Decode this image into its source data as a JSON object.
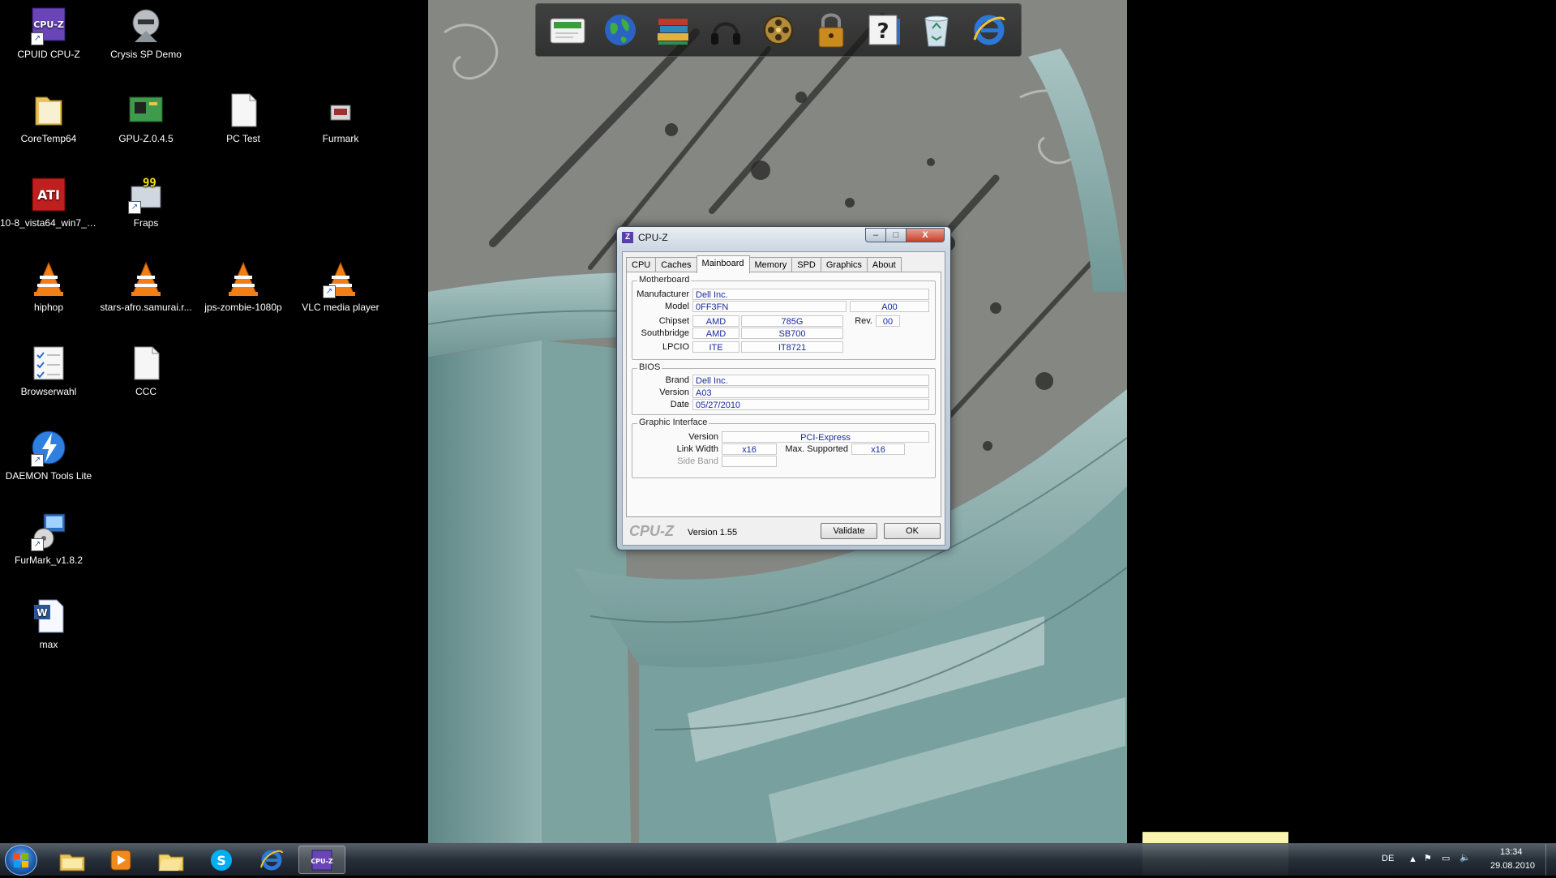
{
  "desktop": {
    "icons": [
      {
        "label": "CPUID CPU-Z",
        "icon": "cpuz-icon"
      },
      {
        "label": "Crysis SP Demo",
        "icon": "crysis-icon"
      },
      {
        "label": "CoreTemp64",
        "icon": "folder-icon"
      },
      {
        "label": "GPU-Z.0.4.5",
        "icon": "gpuz-icon"
      },
      {
        "label": "PC Test",
        "icon": "document-icon"
      },
      {
        "label": "Furmark",
        "icon": "furmark-icon"
      },
      {
        "label": "10-8_vista64_win7_6...",
        "icon": "ati-icon"
      },
      {
        "label": "Fraps",
        "icon": "fraps-icon"
      },
      {
        "label": "hiphop",
        "icon": "vlc-icon"
      },
      {
        "label": "stars-afro.samurai.r...",
        "icon": "vlc-icon"
      },
      {
        "label": "jps-zombie-1080p",
        "icon": "vlc-icon"
      },
      {
        "label": "VLC media player",
        "icon": "vlc-icon"
      },
      {
        "label": "Browserwahl",
        "icon": "checklist-icon"
      },
      {
        "label": "CCC",
        "icon": "document-icon"
      },
      {
        "label": "DAEMON Tools Lite",
        "icon": "daemon-icon"
      },
      {
        "label": "FurMark_v1.8.2",
        "icon": "furmark-setup-icon"
      },
      {
        "label": "max",
        "icon": "word-icon"
      }
    ]
  },
  "dock": {
    "items": [
      "mail-icon",
      "globe-icon",
      "books-icon",
      "headphones-icon",
      "film-reel-icon",
      "padlock-icon",
      "help-icon",
      "recycle-bin-icon",
      "internet-explorer-icon"
    ]
  },
  "cpuz": {
    "title": "CPU-Z",
    "window_buttons": {
      "minimize": "–",
      "maximize": "□",
      "close": "X"
    },
    "tabs": [
      "CPU",
      "Caches",
      "Mainboard",
      "Memory",
      "SPD",
      "Graphics",
      "About"
    ],
    "active_tab": "Mainboard",
    "motherboard": {
      "label": "Motherboard",
      "manufacturer_label": "Manufacturer",
      "manufacturer": "Dell Inc.",
      "model_label": "Model",
      "model": "0FF3FN",
      "model_rev": "A00",
      "chipset_label": "Chipset",
      "chipset_vendor": "AMD",
      "chipset_model": "785G",
      "rev_label": "Rev.",
      "rev": "00",
      "southbridge_label": "Southbridge",
      "southbridge_vendor": "AMD",
      "southbridge_model": "SB700",
      "lpcio_label": "LPCIO",
      "lpcio_vendor": "ITE",
      "lpcio_model": "IT8721"
    },
    "bios": {
      "label": "BIOS",
      "brand_label": "Brand",
      "brand": "Dell Inc.",
      "version_label": "Version",
      "version": "A03",
      "date_label": "Date",
      "date": "05/27/2010"
    },
    "graphic_interface": {
      "label": "Graphic Interface",
      "version_label": "Version",
      "version": "PCI-Express",
      "link_width_label": "Link Width",
      "link_width": "x16",
      "max_supported_label": "Max. Supported",
      "max_supported": "x16",
      "side_band_label": "Side Band",
      "side_band": ""
    },
    "footer": {
      "brand": "CPU-Z",
      "version": "Version 1.55",
      "validate_label": "Validate",
      "ok_label": "OK"
    }
  },
  "taskbar": {
    "items": [
      "explorer-icon",
      "media-player-icon",
      "folder-icon",
      "skype-icon",
      "internet-explorer-icon",
      "cpuz-icon"
    ],
    "active_item": "cpuz-icon",
    "language": "DE",
    "time": "13:34",
    "date": "29.08.2010"
  },
  "sticky_note": {
    "text": ""
  }
}
